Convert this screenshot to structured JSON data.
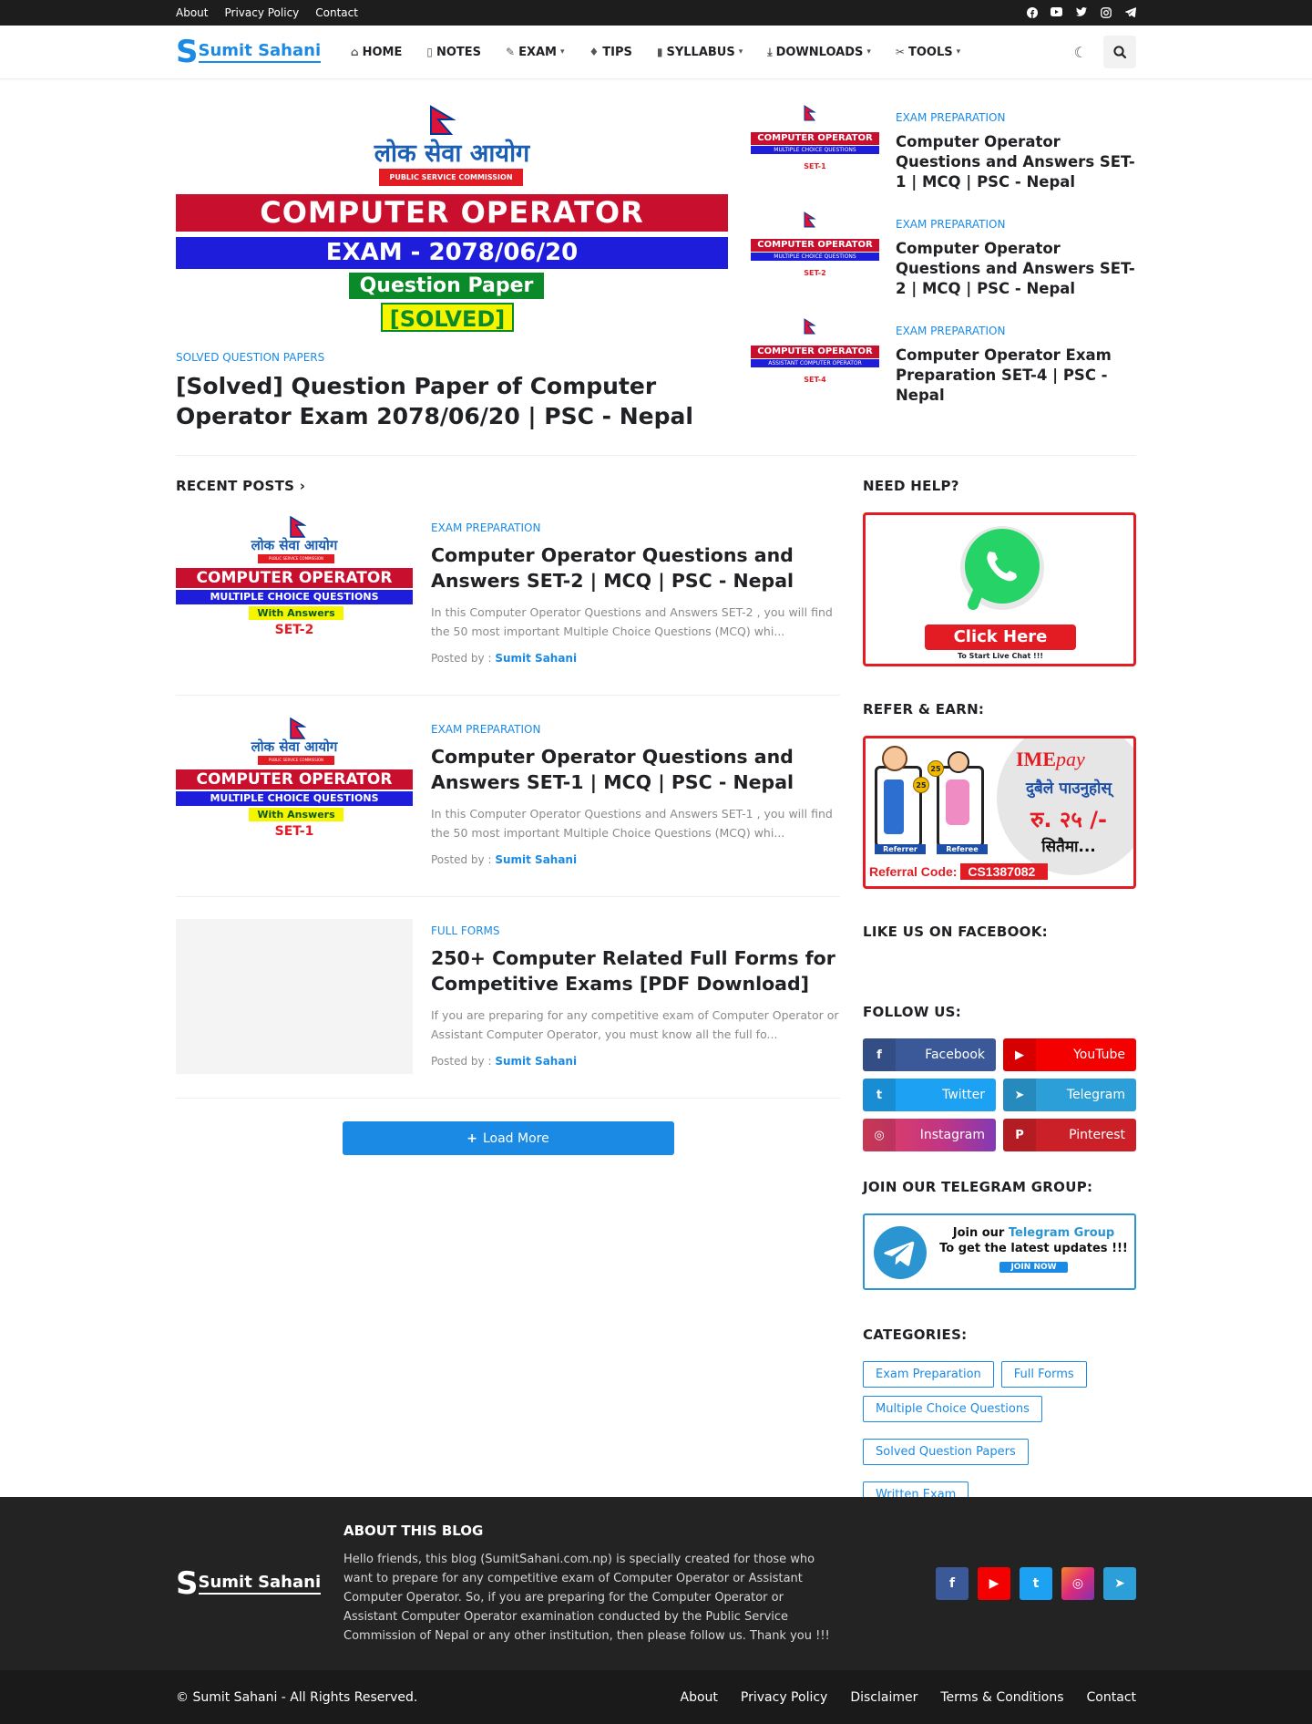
{
  "topbar": {
    "links": [
      "About",
      "Privacy Policy",
      "Contact"
    ],
    "social_icons": [
      "facebook-icon",
      "youtube-icon",
      "twitter-icon",
      "instagram-icon",
      "telegram-icon"
    ]
  },
  "header": {
    "logo_mark": "S",
    "logo_text": "Sumit Sahani",
    "nav": [
      {
        "label": "HOME",
        "icon": "home-icon"
      },
      {
        "label": "NOTES",
        "icon": "file-icon"
      },
      {
        "label": "EXAM",
        "icon": "edit-icon"
      },
      {
        "label": "TIPS",
        "icon": "bulb-icon"
      },
      {
        "label": "SYLLABUS",
        "icon": "book-icon"
      },
      {
        "label": "DOWNLOADS",
        "icon": "download-icon"
      },
      {
        "label": "TOOLS",
        "icon": "tools-icon"
      }
    ]
  },
  "featured": {
    "main": {
      "image": {
        "line1": "लोक सेवा आयोग",
        "line2": "PUBLIC SERVICE COMMISSION",
        "line3": "COMPUTER OPERATOR",
        "line4": "EXAM - 2078/06/20",
        "line5": "Question Paper",
        "line6": "[SOLVED]"
      },
      "category": "SOLVED QUESTION PAPERS",
      "title": "[Solved] Question Paper of Computer Operator Exam 2078/06/20 | PSC - Nepal"
    },
    "side": [
      {
        "category": "EXAM PREPARATION",
        "title": "Computer Operator Questions and Answers SET-1 | MCQ | PSC - Nepal",
        "thumb_set": "SET-1",
        "thumb_sub": "MULTIPLE CHOICE QUESTIONS"
      },
      {
        "category": "EXAM PREPARATION",
        "title": "Computer Operator Questions and Answers SET-2 | MCQ | PSC - Nepal",
        "thumb_set": "SET-2",
        "thumb_sub": "MULTIPLE CHOICE QUESTIONS"
      },
      {
        "category": "EXAM PREPARATION",
        "title": "Computer Operator Exam Preparation SET-4 | PSC - Nepal",
        "thumb_set": "SET-4",
        "thumb_sub": "ASSISTANT COMPUTER OPERATOR"
      }
    ]
  },
  "recent": {
    "title": "RECENT POSTS",
    "posts": [
      {
        "category": "EXAM PREPARATION",
        "title": "Computer Operator Questions and Answers SET-2 | MCQ | PSC - Nepal",
        "excerpt": "In this  Computer Operator Questions and Answers SET-2 , you will find the 50 most important Multiple Choice Questions (MCQ) whi...",
        "posted_by": "Posted by :",
        "author": "Sumit Sahani",
        "thumb": {
          "top": "लोक सेवा आयोग",
          "psc": "PUBLIC SERVICE COMMISSION",
          "main": "COMPUTER OPERATOR",
          "sub": "MULTIPLE CHOICE QUESTIONS",
          "ans": "With Answers",
          "set": "SET-2"
        }
      },
      {
        "category": "EXAM PREPARATION",
        "title": "Computer Operator Questions and Answers SET-1 | MCQ | PSC - Nepal",
        "excerpt": "In this  Computer Operator Questions and Answers SET-1 , you will find the 50 most important Multiple Choice Questions (MCQ) whi...",
        "posted_by": "Posted by :",
        "author": "Sumit Sahani",
        "thumb": {
          "top": "लोक सेवा आयोग",
          "psc": "PUBLIC SERVICE COMMISSION",
          "main": "COMPUTER OPERATOR",
          "sub": "MULTIPLE CHOICE QUESTIONS",
          "ans": "With Answers",
          "set": "SET-1"
        }
      },
      {
        "category": "FULL FORMS",
        "title": "250+ Computer Related Full Forms for Competitive Exams [PDF Download]",
        "excerpt": "If you are preparing for any competitive exam of Computer Operator or Assistant Computer Operator, you must know all the full fo...",
        "posted_by": "Posted by :",
        "author": "Sumit Sahani"
      }
    ],
    "load_more": "Load More"
  },
  "sidebar": {
    "need_help": "NEED HELP?",
    "wa_button": "Click Here",
    "wa_sub": "To Start Live Chat !!!",
    "refer": "REFER & EARN:",
    "ime": {
      "brand1": "IME",
      "brand2": "pay",
      "line1": "दुबैले पाउनुहोस्",
      "line2": "रु. २५ /-",
      "line3": "सितैमा...",
      "referrer": "Referrer",
      "referee": "Referee",
      "code_label": "Referral Code:",
      "code": "CS1387082",
      "coin": "25"
    },
    "like_fb": "LIKE US ON FACEBOOK:",
    "follow_title": "FOLLOW US:",
    "follow": [
      {
        "label": "Facebook",
        "color": "#3b5998",
        "icon": "f"
      },
      {
        "label": "YouTube",
        "color": "#f50000",
        "icon": "▶"
      },
      {
        "label": "Twitter",
        "color": "#1da1f2",
        "icon": "t"
      },
      {
        "label": "Telegram",
        "color": "#2c9ed8",
        "icon": "➤"
      },
      {
        "label": "Instagram",
        "color": "#c13584",
        "icon": "◎"
      },
      {
        "label": "Pinterest",
        "color": "#cb2027",
        "icon": "P"
      }
    ],
    "telegram_title": "JOIN OUR TELEGRAM GROUP:",
    "tg": {
      "l1a": "Join our ",
      "l1b": "Telegram Group",
      "l2": "To get the latest updates !!!",
      "btn": "JOIN NOW"
    },
    "categories_title": "CATEGORIES:",
    "categories": [
      "Exam Preparation",
      "Full Forms",
      "Multiple Choice Questions",
      "Solved Question Papers",
      "Written Exam"
    ]
  },
  "footer": {
    "logo_mark": "S",
    "logo_text": "Sumit Sahani",
    "about_title": "ABOUT THIS BLOG",
    "about_text": "Hello friends, this blog (SumitSahani.com.np) is specially created for those who want to prepare for any competitive exam of Computer Operator or Assistant Computer Operator. So, if you are preparing for the Computer Operator or Assistant Computer Operator examination conducted by the Public Service Commission of Nepal or any other institution, then please follow us. Thank you !!!",
    "copyright": "© Sumit Sahani - All Rights Reserved.",
    "links": [
      "About",
      "Privacy Policy",
      "Disclaimer",
      "Terms & Conditions",
      "Contact"
    ]
  },
  "colors": {
    "accent": "#1a8ae5",
    "topbar": "#1d1d1d",
    "footer": "#232323",
    "red": "#e31b23"
  }
}
